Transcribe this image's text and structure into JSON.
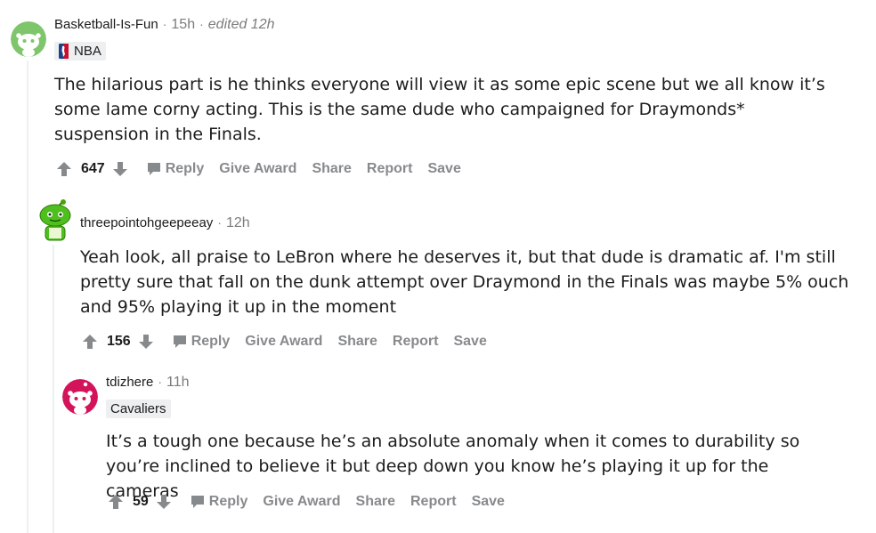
{
  "colors": {
    "upvote": "#878a8c",
    "text": "#1c1c1c",
    "meta": "#7c7c7c",
    "flair_bg": "#edeff1",
    "action": "#878a8c"
  },
  "comments": [
    {
      "username": "Basketball-Is-Fun",
      "time": "15h",
      "edited": "edited 12h",
      "flair": "NBA",
      "body": "The hilarious part is he thinks everyone will view it as some epic scene but we all know it’s some lame corny acting. This is the same dude who campaigned for Draymonds* suspension in the Finals.",
      "score": "647",
      "avatar": "snoo-white-icon"
    },
    {
      "username": "threepointohgeepeeay",
      "time": "12h",
      "body": "Yeah look, all praise to LeBron where he deserves it, but that dude is dramatic af. I'm still pretty sure that fall on the dunk attempt over Draymond in the Finals was maybe 5% ouch and 95% playing it up in the moment",
      "score": "156",
      "avatar": "snoo-green-icon"
    },
    {
      "username": "tdizhere",
      "time": "11h",
      "flair": "Cavaliers",
      "body": "It’s a tough one because he’s an absolute anomaly when it comes to durability so you’re inclined to believe it but deep down you know he’s playing it up for the cameras",
      "score": "59",
      "avatar": "snoo-red-icon"
    }
  ],
  "actions": {
    "reply": "Reply",
    "give_award": "Give Award",
    "share": "Share",
    "report": "Report",
    "save": "Save"
  }
}
